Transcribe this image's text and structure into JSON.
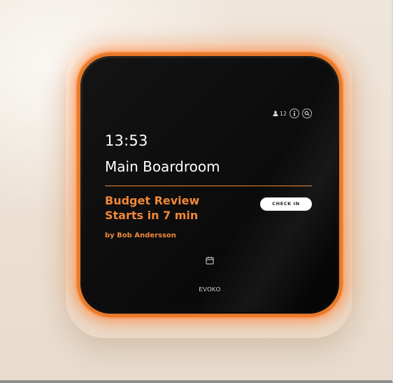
{
  "status": {
    "occupancy_count": "12",
    "info_icon": "info-icon",
    "search_icon": "search-icon",
    "person_icon": "person-icon"
  },
  "display": {
    "time": "13:53",
    "room_name": "Main Boardroom"
  },
  "meeting": {
    "title": "Budget Review",
    "starts": "Starts in 7 min",
    "organizer": "by Bob Andersson",
    "checkin_label": "CHECK IN"
  },
  "footer": {
    "calendar_icon": "calendar-icon",
    "brand": "EVOKO"
  },
  "colors": {
    "accent": "#f0883a",
    "led_ring": "#e87a2a",
    "screen": "#0b0b0b",
    "wall": "#ece1d4"
  }
}
